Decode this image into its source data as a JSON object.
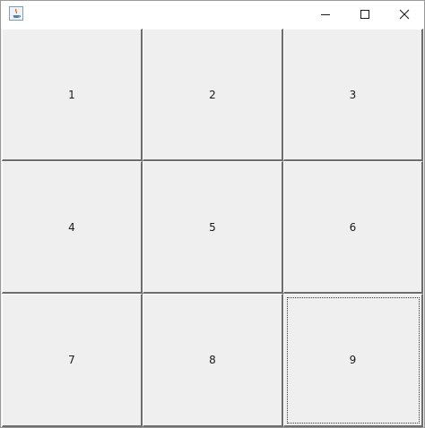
{
  "window": {
    "buttons": {
      "minimize_icon": "minimize-icon",
      "maximize_icon": "maximize-icon",
      "close_icon": "close-icon"
    }
  },
  "grid": {
    "buttons": [
      {
        "label": "1",
        "focused": false
      },
      {
        "label": "2",
        "focused": false
      },
      {
        "label": "3",
        "focused": false
      },
      {
        "label": "4",
        "focused": false
      },
      {
        "label": "5",
        "focused": false
      },
      {
        "label": "6",
        "focused": false
      },
      {
        "label": "7",
        "focused": false
      },
      {
        "label": "8",
        "focused": false
      },
      {
        "label": "9",
        "focused": true
      }
    ]
  },
  "colors": {
    "button_face": "#efefef",
    "button_shadow": "#6d6d6d",
    "titlebar": "#ffffff"
  }
}
